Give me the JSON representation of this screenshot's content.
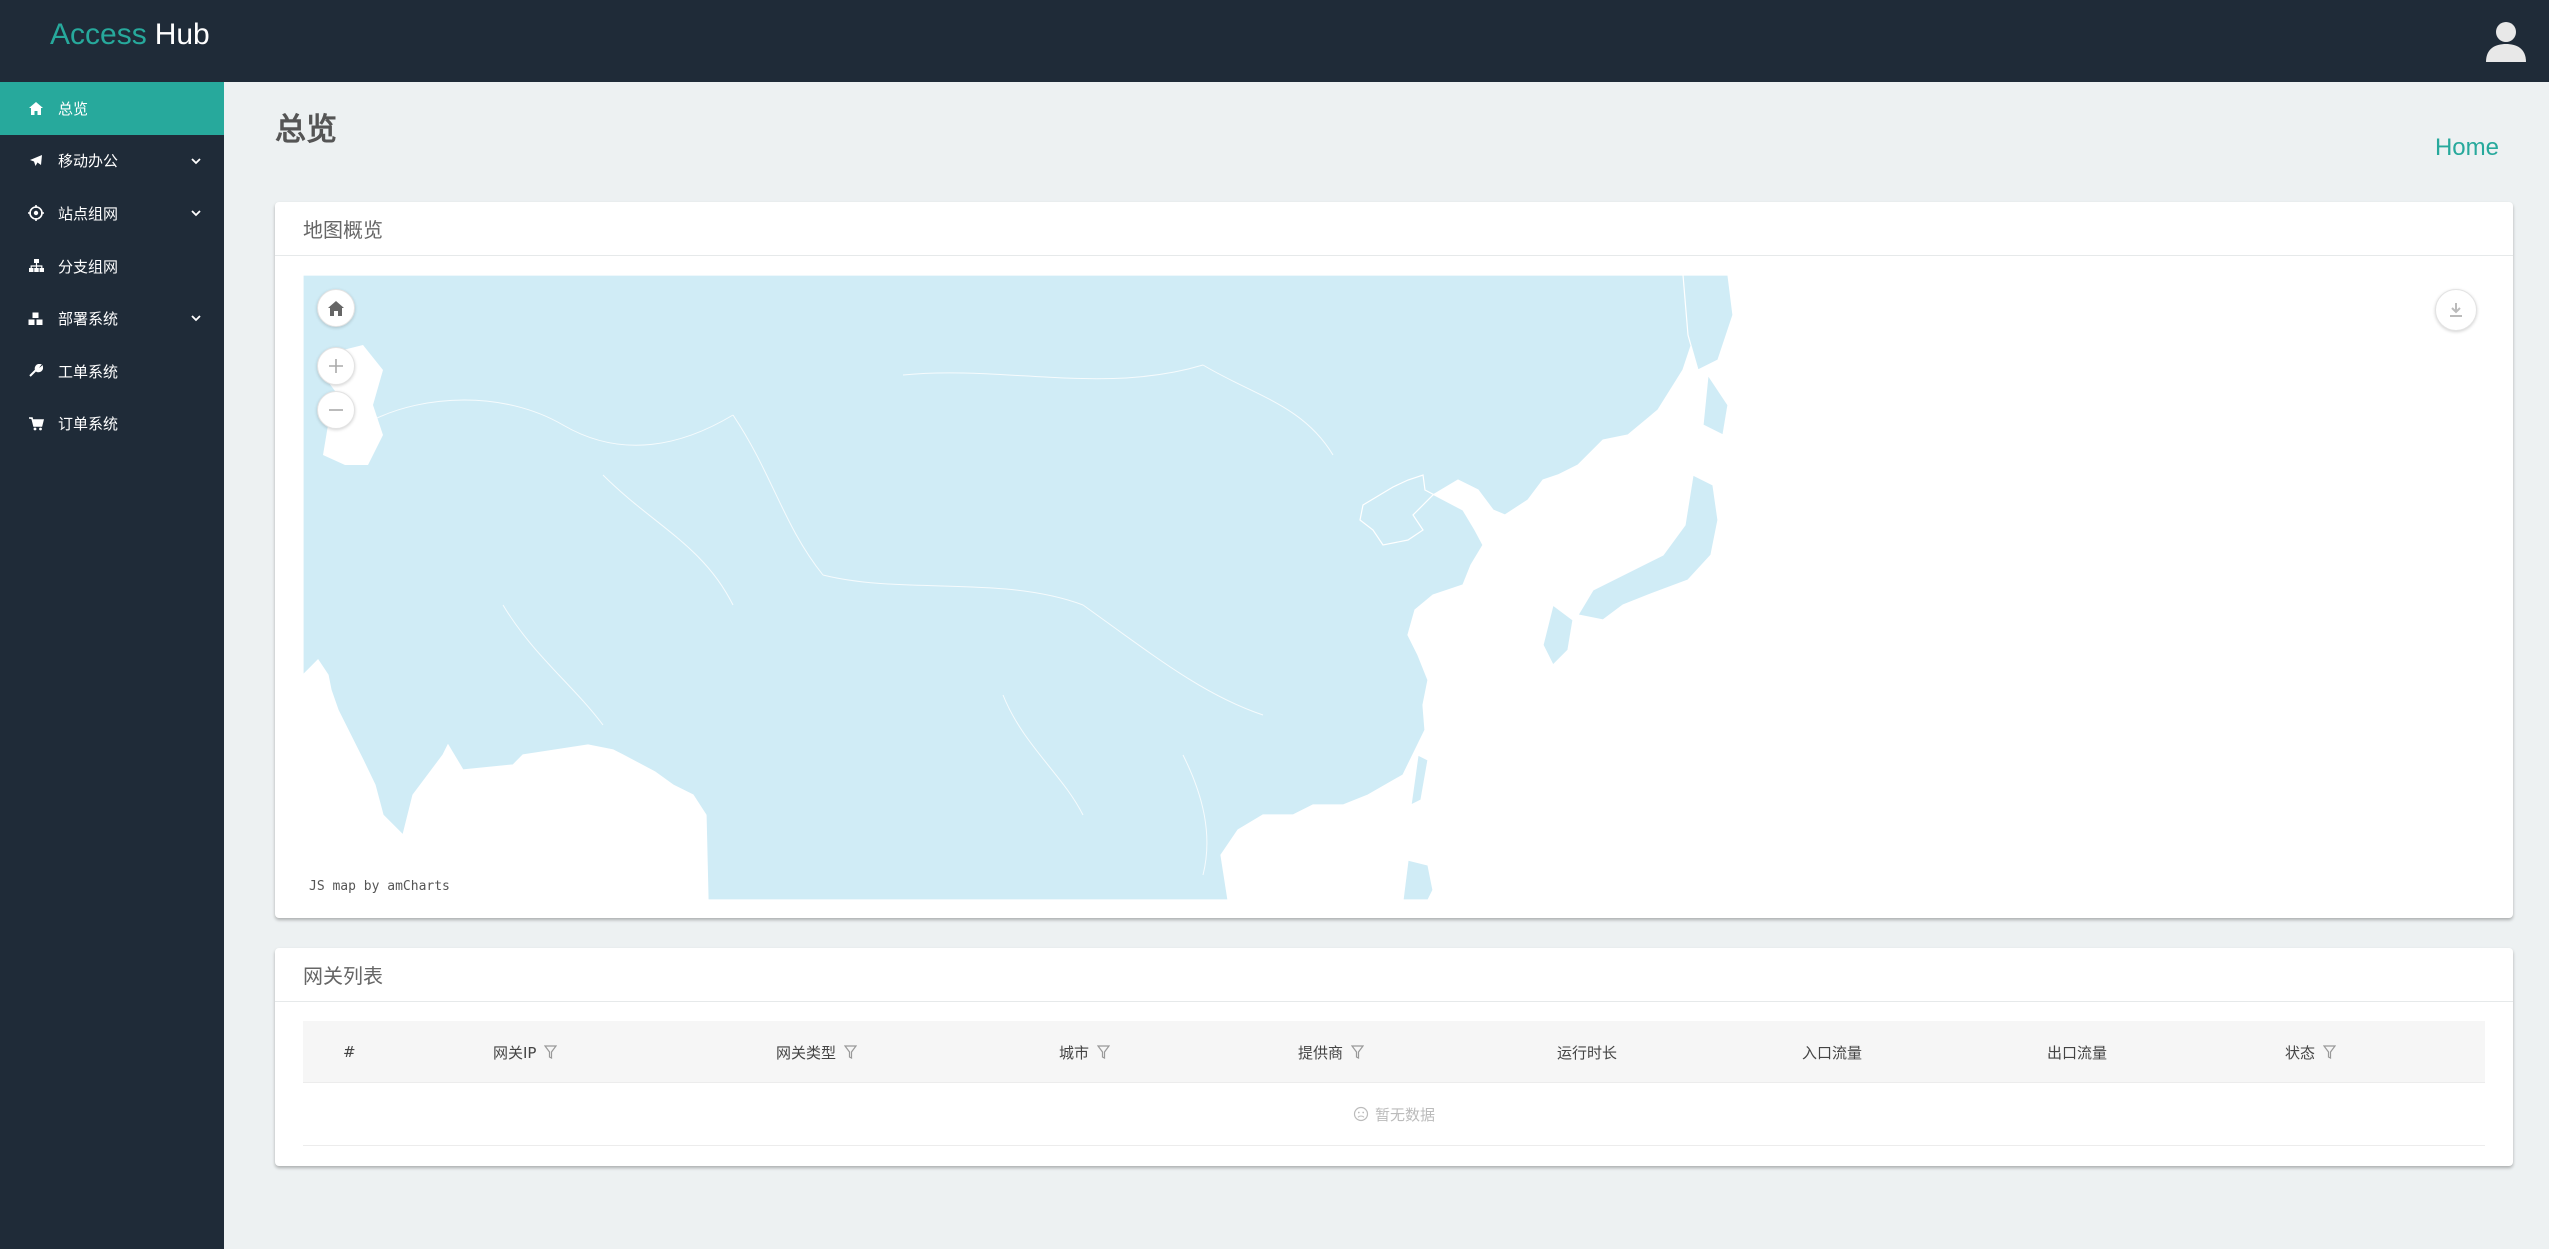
{
  "app": {
    "brand_first": "Access",
    "brand_second": "Hub"
  },
  "icons": {
    "user": "user-icon",
    "home": "home-icon",
    "zoom_in": "zoom-in-icon",
    "zoom_out": "zoom-out-icon",
    "download": "download-icon",
    "filter": "filter-icon"
  },
  "colors": {
    "accent": "#27a99c",
    "sidebar_bg": "#1f2b38",
    "map_land": "#d0ecf6",
    "page_bg": "#edf1f2"
  },
  "sidebar": {
    "items": [
      {
        "label": "总览",
        "icon": "home-icon",
        "expandable": false,
        "active": true
      },
      {
        "label": "移动办公",
        "icon": "plane-icon",
        "expandable": true,
        "active": false
      },
      {
        "label": "站点组网",
        "icon": "network-gear-icon",
        "expandable": true,
        "active": false
      },
      {
        "label": "分支组网",
        "icon": "sitemap-icon",
        "expandable": false,
        "active": false
      },
      {
        "label": "部署系统",
        "icon": "cubes-icon",
        "expandable": true,
        "active": false
      },
      {
        "label": "工单系统",
        "icon": "wrench-icon",
        "expandable": false,
        "active": false
      },
      {
        "label": "订单系统",
        "icon": "cart-icon",
        "expandable": false,
        "active": false
      }
    ]
  },
  "page": {
    "title": "总览",
    "breadcrumb": "Home"
  },
  "map_card": {
    "title": "地图概览",
    "credit": "JS map by amCharts"
  },
  "table_card": {
    "title": "网关列表",
    "columns": [
      {
        "label": "#",
        "filter": false
      },
      {
        "label": "网关IP",
        "filter": true
      },
      {
        "label": "网关类型",
        "filter": true
      },
      {
        "label": "城市",
        "filter": true
      },
      {
        "label": "提供商",
        "filter": true
      },
      {
        "label": "运行时长",
        "filter": false
      },
      {
        "label": "入口流量",
        "filter": false
      },
      {
        "label": "出口流量",
        "filter": false
      },
      {
        "label": "状态",
        "filter": true
      }
    ],
    "rows": [],
    "empty_text": "暂无数据"
  }
}
